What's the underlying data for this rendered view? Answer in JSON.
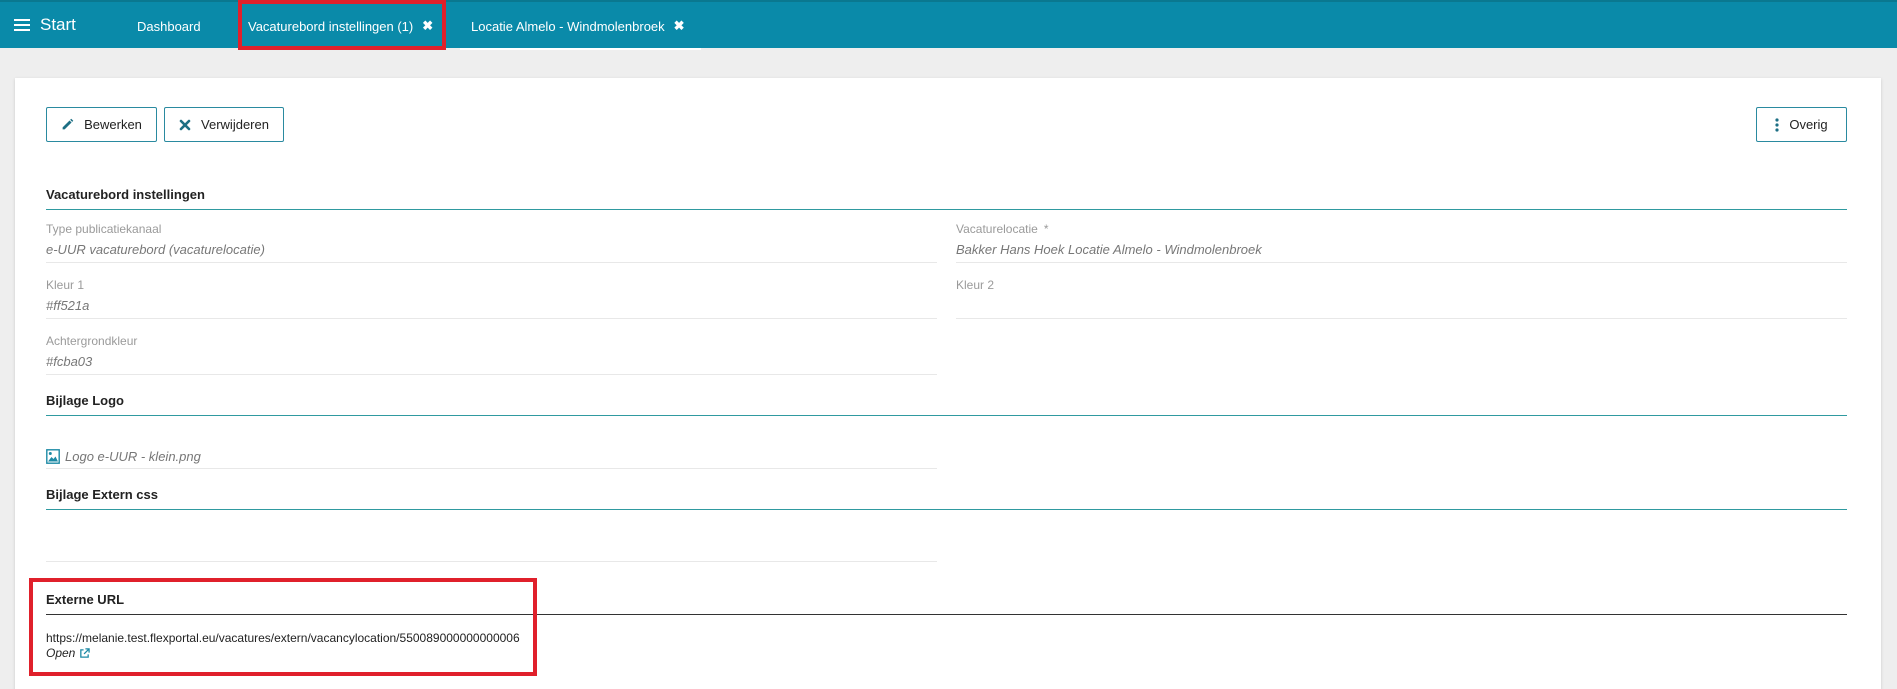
{
  "topbar": {
    "menu_label": "Start",
    "tabs": [
      {
        "label": "Dashboard",
        "closable": false
      },
      {
        "label": "Vacaturebord instellingen (1)",
        "closable": true
      },
      {
        "label": "Locatie Almelo - Windmolenbroek",
        "closable": true,
        "active": true
      }
    ],
    "close_glyph": "✖"
  },
  "toolbar": {
    "edit_label": "Bewerken",
    "delete_label": "Verwijderen",
    "more_label": "Overig"
  },
  "sections": {
    "settings_title": "Vacaturebord instellingen",
    "logo_title": "Bijlage Logo",
    "css_title": "Bijlage Extern css",
    "url_title": "Externe URL"
  },
  "fields": {
    "type_label": "Type publicatiekanaal",
    "type_value": "e-UUR vacaturebord (vacaturelocatie)",
    "location_label": "Vacaturelocatie",
    "location_required": "*",
    "location_value": "Bakker Hans Hoek Locatie Almelo - Windmolenbroek",
    "color1_label": "Kleur 1",
    "color1_value": "#ff521a",
    "color2_label": "Kleur 2",
    "color2_value": "",
    "bg_label": "Achtergrondkleur",
    "bg_value": "#fcba03"
  },
  "logo": {
    "filename": "Logo e-UUR - klein.png",
    "icon": "image-file-icon"
  },
  "external_url": {
    "url": "https://melanie.test.flexportal.eu/vacatures/extern/vacancylocation/550089000000000006",
    "open_label": "Open",
    "icon": "external-link-icon"
  },
  "colors": {
    "topbar": "#0a8aa9",
    "accent": "#2f9aa0",
    "highlight": "#e0202b"
  }
}
